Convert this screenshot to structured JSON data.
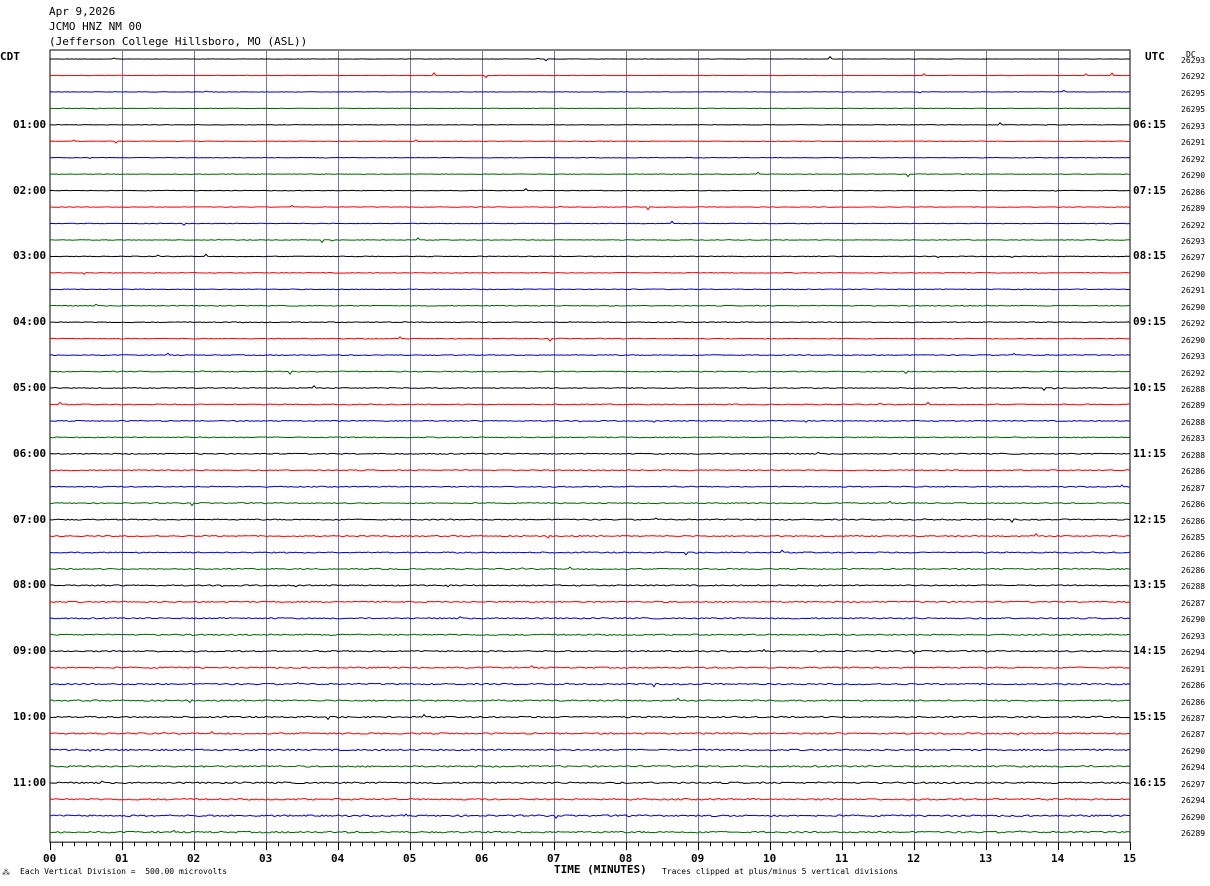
{
  "header": {
    "date": "Apr 9,2026",
    "station": "JCMO HNZ NM 00",
    "location": "(Jefferson College Hillsboro, MO (ASL))"
  },
  "left_axis_label": "CDT",
  "right_axis_label": "UTC",
  "dc_label": "DC",
  "left_hour_labels": [
    "01:00",
    "02:00",
    "03:00",
    "04:00",
    "05:00",
    "06:00",
    "07:00",
    "08:00",
    "09:00",
    "10:00",
    "11:00"
  ],
  "right_hour_labels": [
    "06:15",
    "07:15",
    "08:15",
    "09:15",
    "10:15",
    "11:15",
    "12:15",
    "13:15",
    "14:15",
    "15:15",
    "16:15"
  ],
  "dc_values": [
    "26293",
    "26292",
    "26295",
    "26295",
    "26293",
    "26291",
    "26292",
    "26290",
    "26286",
    "26289",
    "26292",
    "26293",
    "26297",
    "26290",
    "26291",
    "26290",
    "26292",
    "26290",
    "26293",
    "26292",
    "26288",
    "26289",
    "26288",
    "26283",
    "26288",
    "26286",
    "26287",
    "26286",
    "26286",
    "26285",
    "26286",
    "26286",
    "26288",
    "26287",
    "26290",
    "26293",
    "26294",
    "26291",
    "26286",
    "26286",
    "26287",
    "26287",
    "26290",
    "26294",
    "26297",
    "26294",
    "26290",
    "26289"
  ],
  "footer": {
    "scale_note": "Each Vertical Division =  500.00 microvolts",
    "x_title": "TIME (MINUTES)",
    "clip_note": "Traces clipped at plus/minus 5 vertical divisions"
  },
  "chart_data": {
    "type": "line",
    "title": "JCMO HNZ NM 00",
    "xlabel": "TIME (MINUTES)",
    "ylabel": "CDT",
    "x_range": [
      0,
      15
    ],
    "x_ticks": [
      "00",
      "01",
      "02",
      "03",
      "04",
      "05",
      "06",
      "07",
      "08",
      "09",
      "10",
      "11",
      "12",
      "13",
      "14",
      "15"
    ],
    "trace_count": 48,
    "trace_interval_minutes": 15,
    "trace_colors": [
      "#000000",
      "#ff0000",
      "#0000cc",
      "#006600"
    ],
    "grid": true
  }
}
